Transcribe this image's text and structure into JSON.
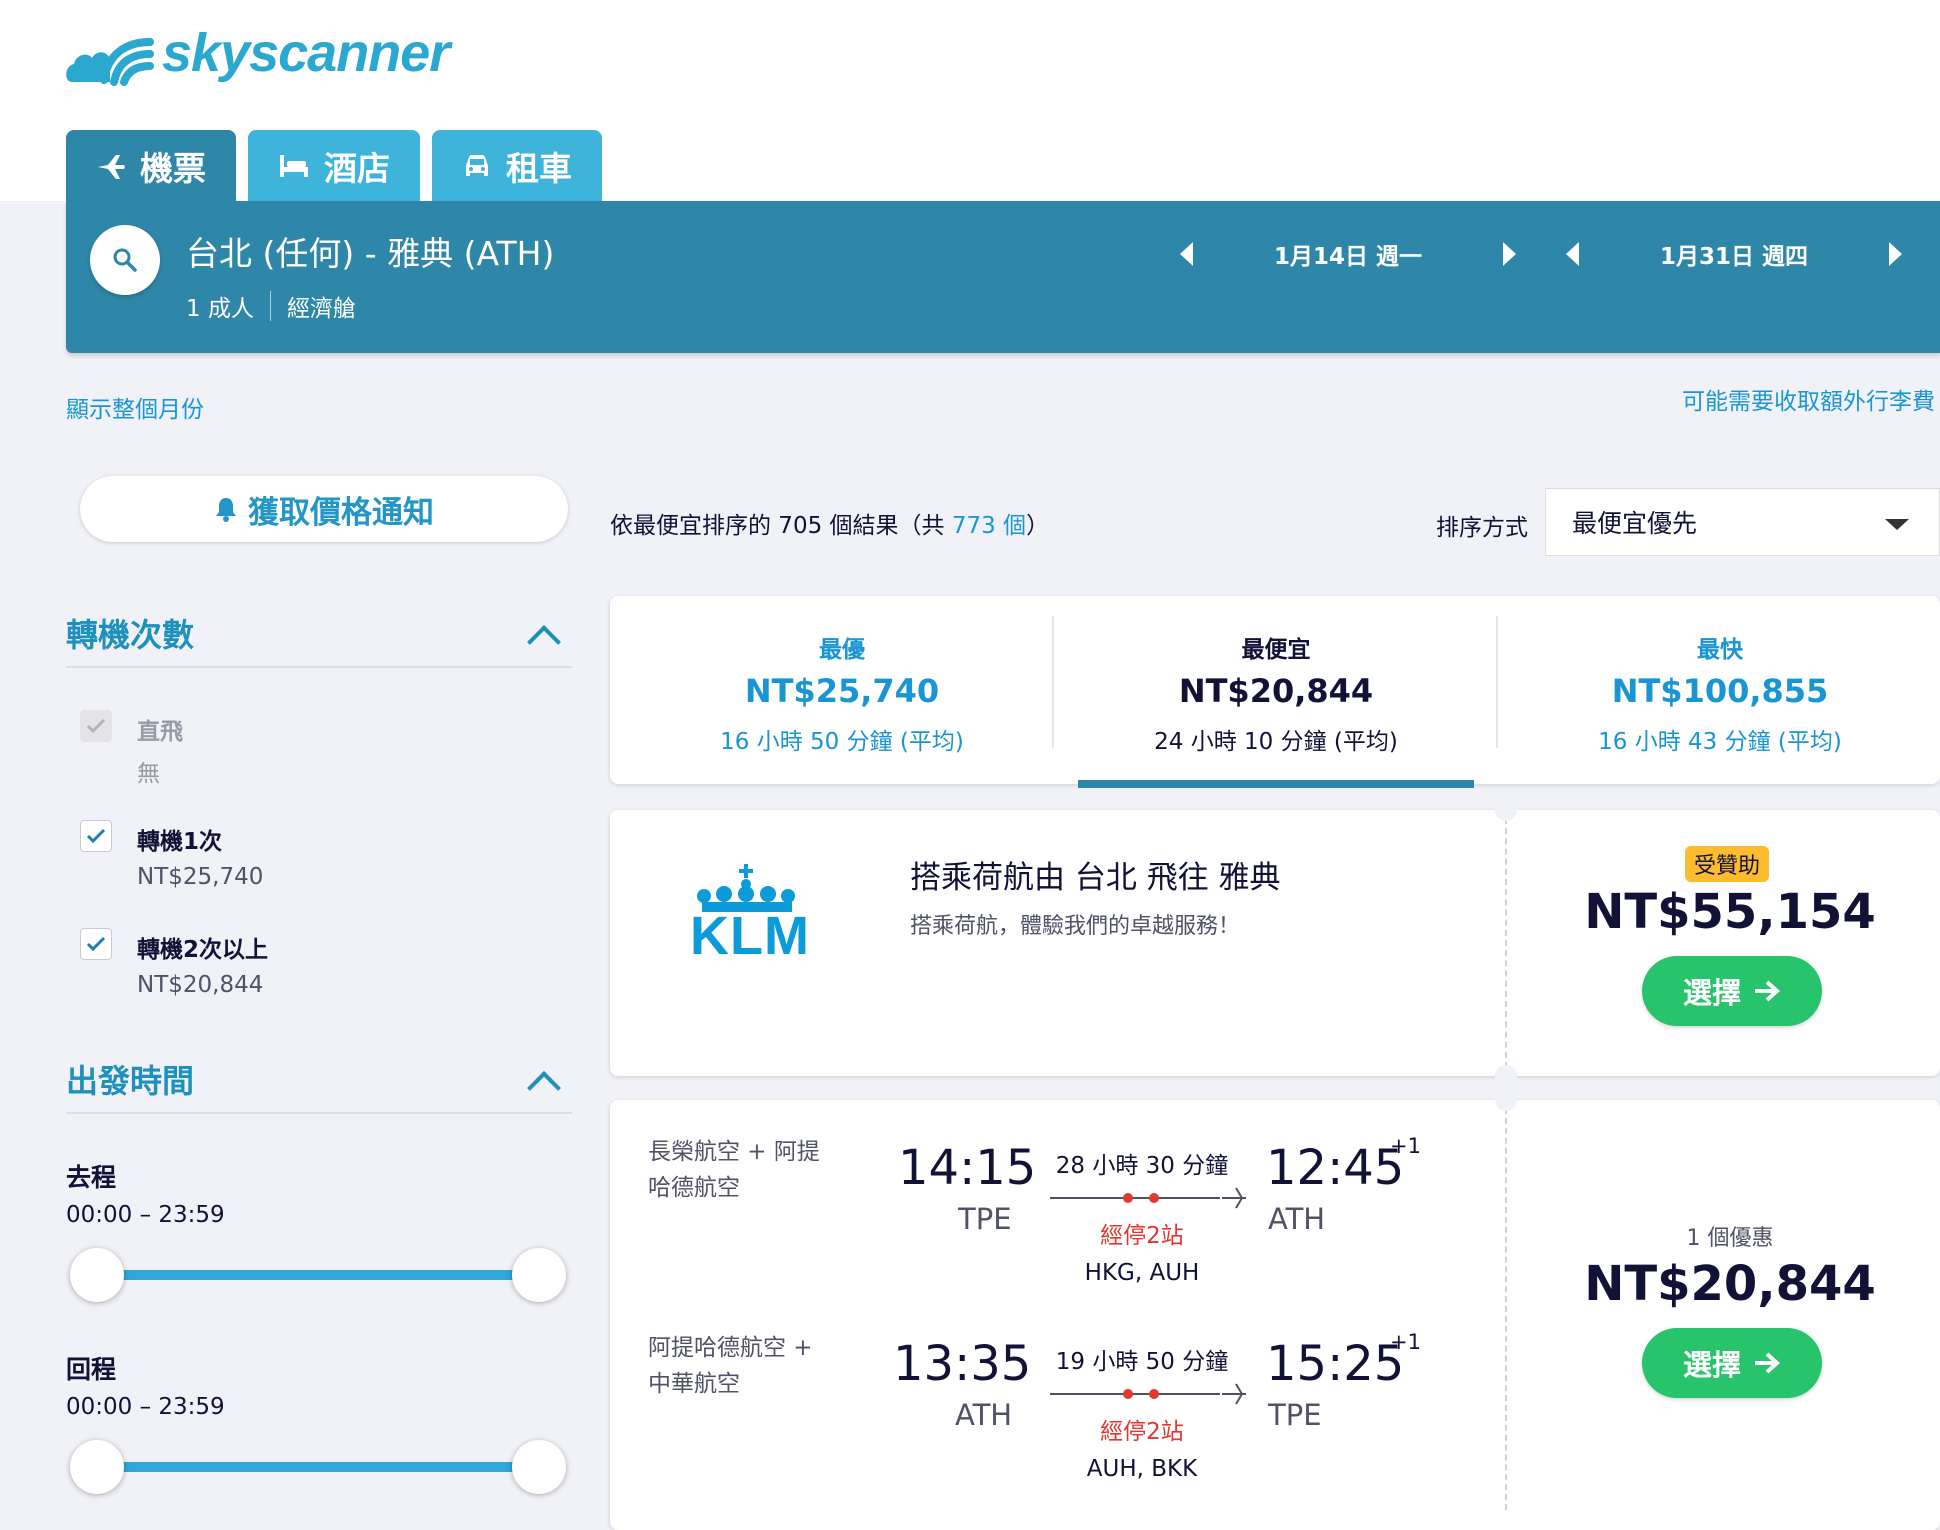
{
  "brand": {
    "name": "skyscanner"
  },
  "tabs": [
    {
      "label": "機票",
      "icon": "airplane-icon"
    },
    {
      "label": "酒店",
      "icon": "bed-icon"
    },
    {
      "label": "租車",
      "icon": "car-icon"
    }
  ],
  "search": {
    "route": "台北 (任何) - 雅典 (ATH)",
    "passengers": "1 成人",
    "cabin": "經濟艙",
    "depart_date": "1月14日 週一",
    "return_date": "1月31日 週四"
  },
  "links": {
    "whole_month": "顯示整個月份",
    "baggage_fee": "可能需要收取額外行李費"
  },
  "alert": {
    "label": "獲取價格通知"
  },
  "results": {
    "prefix": "依最便宜排序的 705 個結果（共 ",
    "total": "773 個",
    "suffix": "）"
  },
  "sort": {
    "label": "排序方式",
    "value": "最便宜優先"
  },
  "filters": {
    "stops": {
      "title": "轉機次數",
      "options": [
        {
          "label": "直飛",
          "sub": "無",
          "checked": true,
          "disabled": true
        },
        {
          "label": "轉機1次",
          "sub": "NT$25,740",
          "checked": true,
          "disabled": false
        },
        {
          "label": "轉機2次以上",
          "sub": "NT$20,844",
          "checked": true,
          "disabled": false
        }
      ]
    },
    "departure": {
      "title": "出發時間",
      "outbound_label": "去程",
      "outbound_range": "00:00 – 23:59",
      "return_label": "回程",
      "return_range": "00:00 – 23:59"
    }
  },
  "summary": [
    {
      "label": "最優",
      "price": "NT$25,740",
      "duration": "16 小時 50 分鐘 (平均)"
    },
    {
      "label": "最便宜",
      "price": "NT$20,844",
      "duration": "24 小時 10 分鐘 (平均)"
    },
    {
      "label": "最快",
      "price": "NT$100,855",
      "duration": "16 小時 43 分鐘 (平均)"
    }
  ],
  "ad": {
    "logo_text": "KLM",
    "title": "搭乘荷航由 台北 飛往 雅典",
    "subtitle": "搭乘荷航，體驗我們的卓越服務！",
    "badge": "受贊助",
    "price": "NT$55,154",
    "select_label": "選擇"
  },
  "itinerary": {
    "offers": "1 個優惠",
    "price": "NT$20,844",
    "select_label": "選擇",
    "legs": [
      {
        "airline_line1": "長榮航空 + 阿提",
        "airline_line2": "哈德航空",
        "depart_time": "14:15",
        "depart_code": "TPE",
        "duration": "28 小時 30 分鐘",
        "stops": "經停2站",
        "stop_codes": "HKG, AUH",
        "arrive_time": "12:45",
        "arrive_code": "ATH",
        "day_offset": "+1"
      },
      {
        "airline_line1": "阿提哈德航空 +",
        "airline_line2": "中華航空",
        "depart_time": "13:35",
        "depart_code": "ATH",
        "duration": "19 小時 50 分鐘",
        "stops": "經停2站",
        "stop_codes": "AUH, BKK",
        "arrive_time": "15:25",
        "arrive_code": "TPE",
        "day_offset": "+1"
      }
    ]
  },
  "colors": {
    "accent": "#2e87a8",
    "link": "#1a95d3",
    "select": "#27c46c",
    "stops": "#e5362e",
    "badge": "#fdbb30"
  }
}
